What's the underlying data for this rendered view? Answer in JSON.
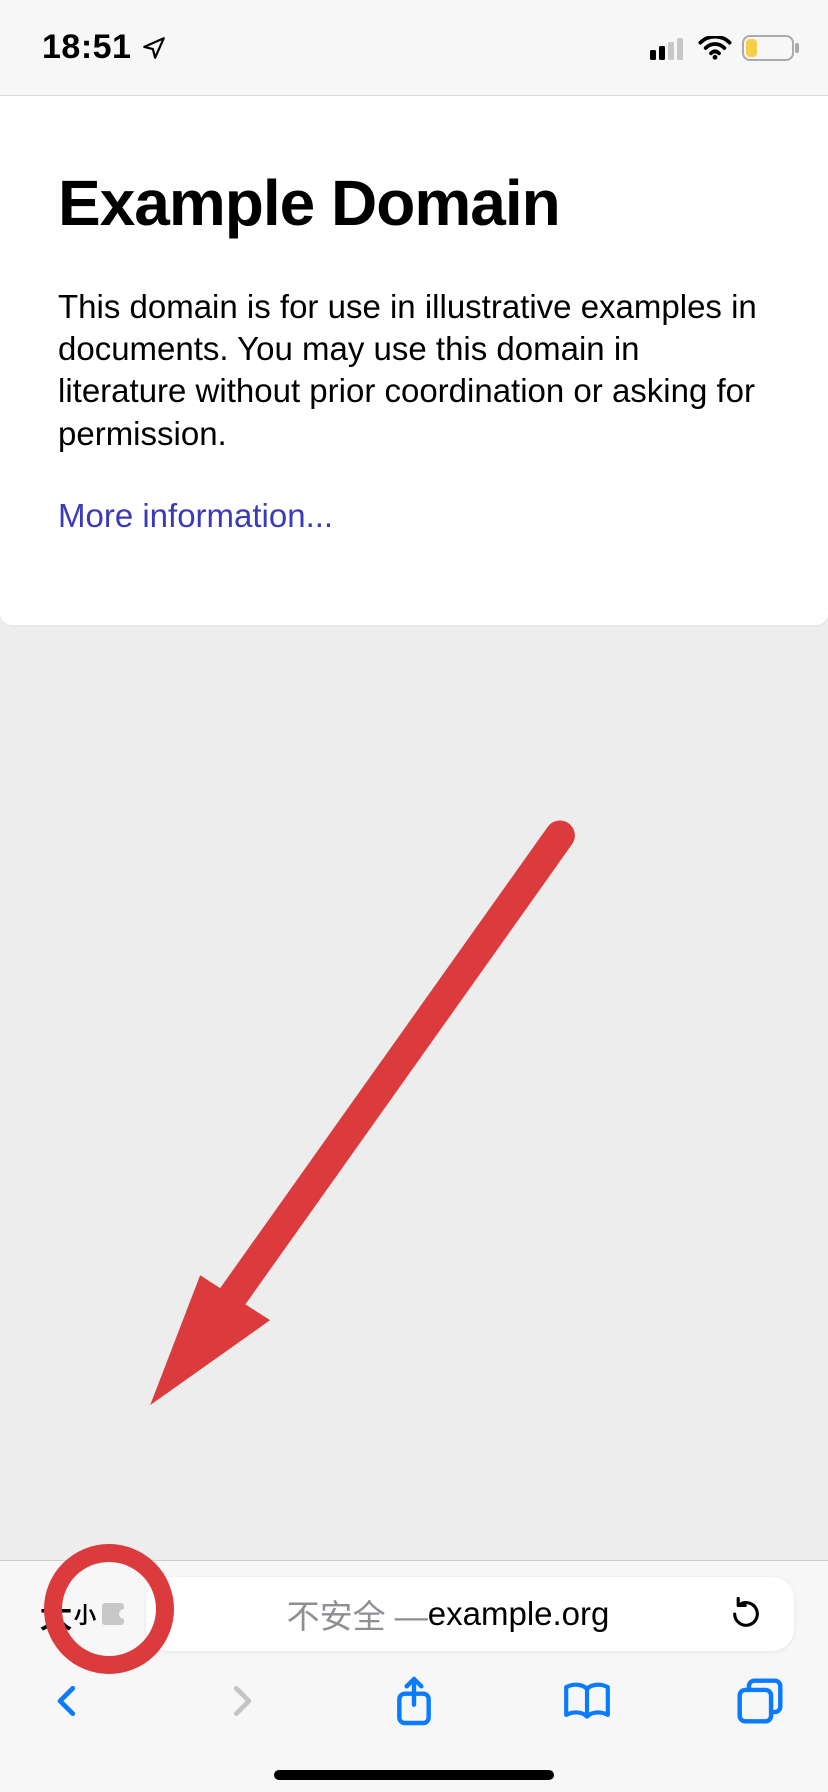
{
  "status": {
    "time": "18:51"
  },
  "page": {
    "title": "Example Domain",
    "paragraph": "This domain is for use in illustrative examples in documents. You may use this domain in literature without prior coordination or asking for permission.",
    "more_link_label": "More information..."
  },
  "url_bar": {
    "aa_big": "大",
    "aa_small": "小",
    "insecure_label": "不安全 — ",
    "host": "example.org"
  },
  "annotation": {
    "color": "#dc3b3e"
  }
}
